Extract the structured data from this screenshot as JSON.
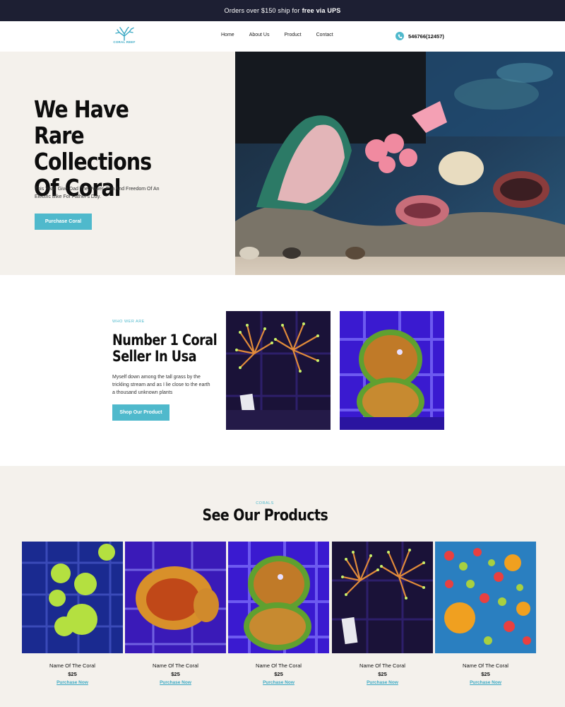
{
  "topbar": {
    "text": "Orders over $150 ship for",
    "bold": "free via UPS"
  },
  "header": {
    "logo_text": "CORAL REEF",
    "nav": [
      "Home",
      "About Us",
      "Product",
      "Contact"
    ],
    "phone": "546766(12457)"
  },
  "hero": {
    "title_lines": [
      "We Have Rare",
      "Collections",
      "Of Coral"
    ],
    "subtitle": "This Year, Give Dad The Power, Fun And Freedom Of An Electric Bike For Father's Day.",
    "button": "Purchase Coral"
  },
  "about": {
    "tag": "WHO WER ARE",
    "title_lines": [
      "Number 1 Coral",
      "Seller In Usa"
    ],
    "text": "Myself down among the tall grass by the trickling stream and as I lie close to the earth a thousand unknown plants",
    "button": "Shop Our Product"
  },
  "products": {
    "tag": "CORALS",
    "title": "See Our Products",
    "items": [
      {
        "name": "Name Of The Coral",
        "price": "$25",
        "link": "Purchase Now"
      },
      {
        "name": "Name Of The Coral",
        "price": "$25",
        "link": "Purchase Now"
      },
      {
        "name": "Name Of The Coral",
        "price": "$25",
        "link": "Purchase Now"
      },
      {
        "name": "Name Of The Coral",
        "price": "$25",
        "link": "Purchase Now"
      },
      {
        "name": "Name Of The Coral",
        "price": "$25",
        "link": "Purchase Now"
      }
    ]
  },
  "colors": {
    "accent": "#4fb9cc",
    "topbar": "#1d1f33",
    "cream": "#f4f1ec"
  }
}
